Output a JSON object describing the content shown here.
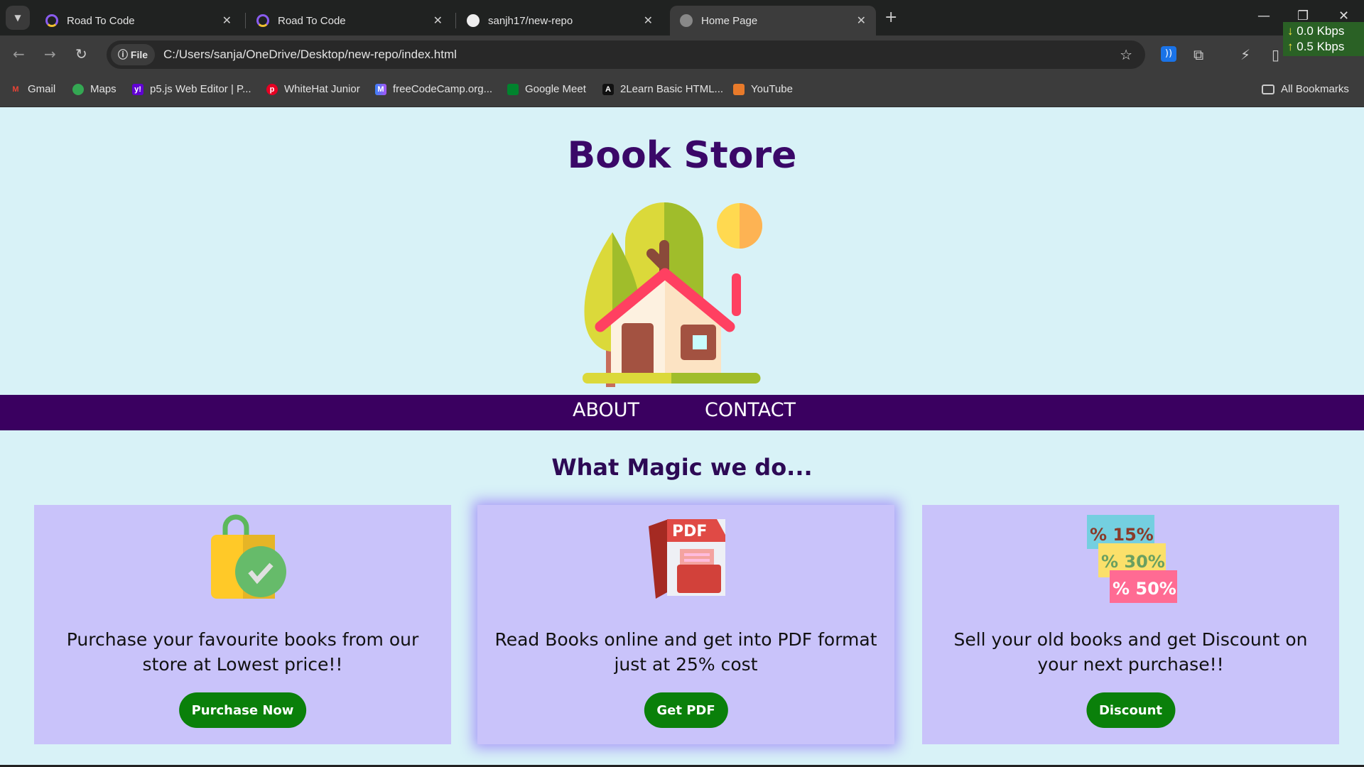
{
  "browser": {
    "tabs": [
      {
        "title": "Road To Code",
        "icon": "road-to-code-icon"
      },
      {
        "title": "Road To Code",
        "icon": "road-to-code-icon"
      },
      {
        "title": "sanjh17/new-repo",
        "icon": "github-icon"
      },
      {
        "title": "Home Page",
        "icon": "globe-icon",
        "active": true
      }
    ],
    "address_chip": "File",
    "url": "C:/Users/sanja/OneDrive/Desktop/new-repo/index.html",
    "network": {
      "down": "0.0 Kbps",
      "up": "0.5 Kbps"
    },
    "bookmarks": [
      "Gmail",
      "Maps",
      "p5.js Web Editor | P...",
      "WhiteHat Junior",
      "freeCodeCamp.org...",
      "Google Meet",
      "2Learn Basic HTML...",
      "YouTube"
    ],
    "all_bookmarks": "All Bookmarks"
  },
  "page": {
    "title": "Book Store",
    "nav": [
      "ABOUT",
      "CONTACT"
    ],
    "subtitle": "What Magic we do...",
    "cards": [
      {
        "text": "Purchase your favourite books from our store at Lowest price!!",
        "button": "Purchase Now",
        "icon": "shopping-bag-check-icon"
      },
      {
        "text": "Read Books online and get into PDF format just at 25% cost",
        "button": "Get PDF",
        "icon": "pdf-file-icon"
      },
      {
        "text": "Sell your old books and get Discount on your next purchase!!",
        "button": "Discount",
        "icon": "discount-tags-icon",
        "tags": [
          "15%",
          "30%",
          "50%"
        ],
        "pdf_label": "PDF"
      }
    ]
  },
  "colors": {
    "page_bg": "#d8f2f7",
    "title": "#3a0868",
    "nav_bg": "#3a0060",
    "card_bg": "#c9c3fa",
    "button": "#0a800a"
  }
}
